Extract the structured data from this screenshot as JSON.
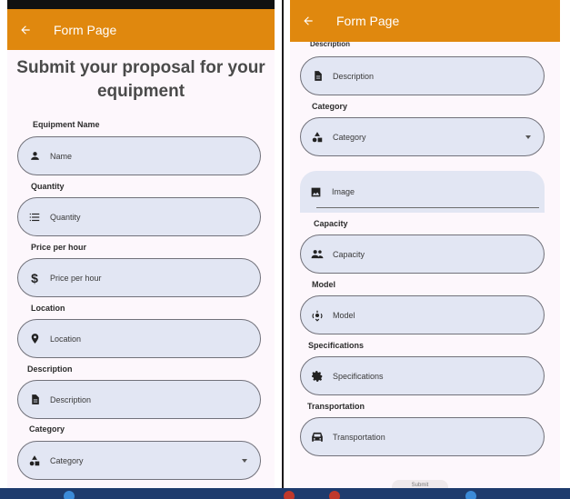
{
  "app": {
    "title": "Form Page",
    "accent": "#e0880e"
  },
  "left": {
    "heading": "Submit your proposal for your equipment",
    "fields": [
      {
        "label": "Equipment Name",
        "placeholder": "Name",
        "icon": "person-icon"
      },
      {
        "label": "Quantity",
        "placeholder": "Quantity",
        "icon": "list-icon"
      },
      {
        "label": "Price per hour",
        "placeholder": "Price per hour",
        "icon": "dollar-icon"
      },
      {
        "label": "Location",
        "placeholder": "Location",
        "icon": "location-pin-icon"
      },
      {
        "label": "Description",
        "placeholder": "Description",
        "icon": "document-icon"
      },
      {
        "label": "Category",
        "placeholder": "Category",
        "icon": "category-shapes-icon"
      }
    ]
  },
  "right": {
    "partial_label": "Description",
    "fields": [
      {
        "label": "",
        "placeholder": "Description",
        "icon": "document-icon"
      },
      {
        "label": "Category",
        "placeholder": "Category",
        "icon": "category-shapes-icon"
      },
      {
        "label": "",
        "placeholder": "Image",
        "icon": "image-icon"
      },
      {
        "label": "Capacity",
        "placeholder": "Capacity",
        "icon": "people-icon"
      },
      {
        "label": "Model",
        "placeholder": "Model",
        "icon": "model-icon"
      },
      {
        "label": "Specifications",
        "placeholder": "Specifications",
        "icon": "gear-icon"
      },
      {
        "label": "Transportation",
        "placeholder": "Transportation",
        "icon": "car-icon"
      }
    ],
    "submit_label": "Submit"
  },
  "colors": {
    "field_fill": "#e2e6f3",
    "taskbar": "#1e3b6d"
  }
}
